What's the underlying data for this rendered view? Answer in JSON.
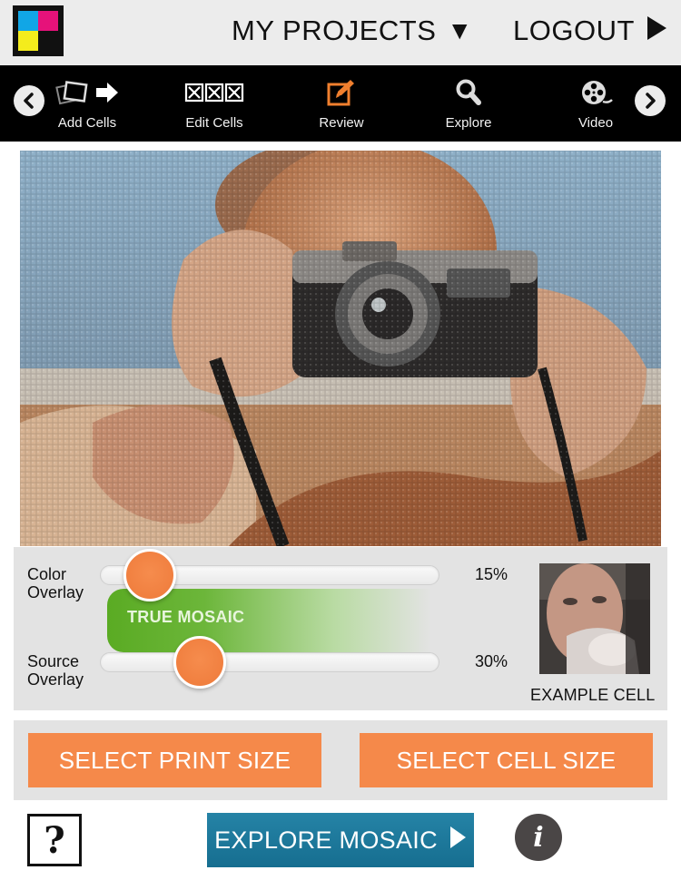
{
  "header": {
    "projects_label": "MY PROJECTS",
    "logout_label": "LOGOUT"
  },
  "toolbar": {
    "items": [
      {
        "label": "Add Cells",
        "icon": "add-cells-icon"
      },
      {
        "label": "Edit Cells",
        "icon": "edit-cells-icon"
      },
      {
        "label": "Review",
        "icon": "review-icon"
      },
      {
        "label": "Explore",
        "icon": "explore-icon"
      },
      {
        "label": "Video",
        "icon": "video-icon"
      }
    ]
  },
  "overlay": {
    "color_label_1": "Color",
    "color_label_2": "Overlay",
    "color_value": 0.15,
    "color_percent": "15%",
    "true_mosaic_label": "TRUE MOSAIC",
    "source_label_1": "Source",
    "source_label_2": "Overlay",
    "source_value": 0.3,
    "source_percent": "30%",
    "example_cell_label": "EXAMPLE CELL"
  },
  "buttons": {
    "print_size": "SELECT PRINT SIZE",
    "cell_size": "SELECT CELL SIZE",
    "help": "?",
    "explore_mosaic": "EXPLORE MOSAIC",
    "info": "i"
  },
  "colors": {
    "accent_orange": "#f5894a",
    "explore_blue": "#1d7a9c",
    "true_mosaic_green": "#5aab23",
    "review_icon_orange": "#f07f2e"
  }
}
